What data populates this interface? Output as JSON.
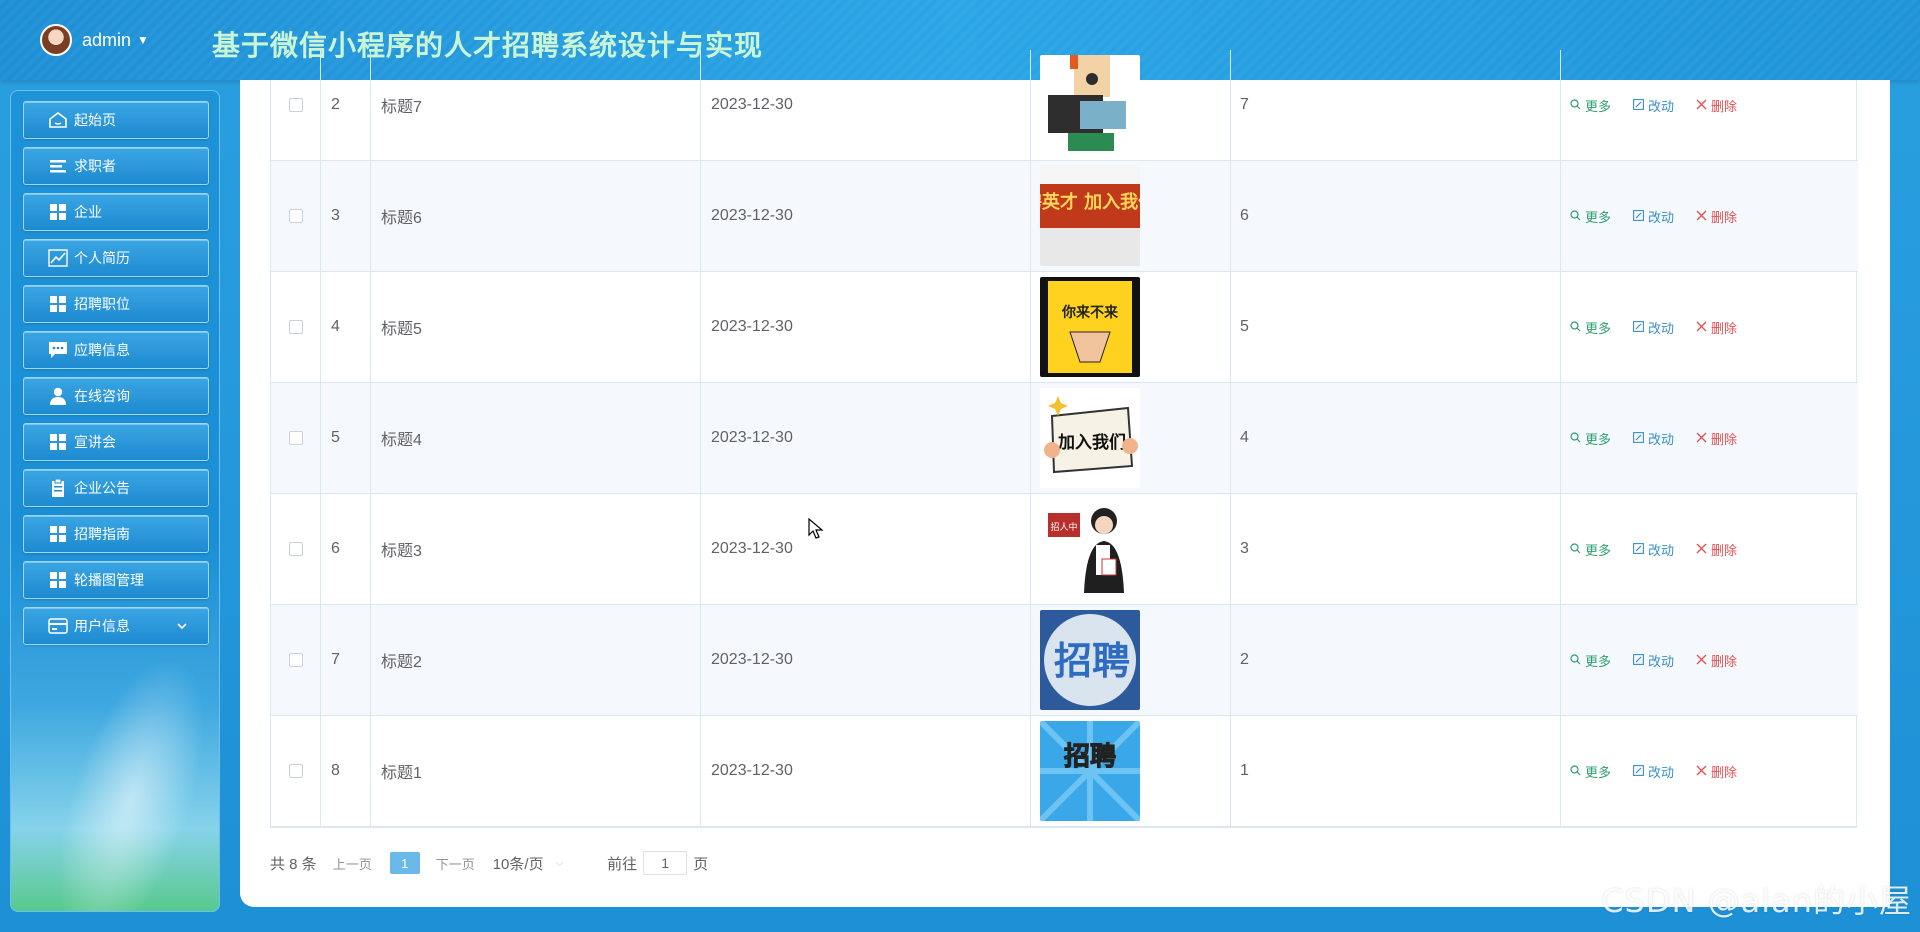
{
  "header": {
    "user_name": "admin",
    "title": "基于微信小程序的人才招聘系统设计与实现"
  },
  "sidebar": {
    "items": [
      {
        "label": "起始页",
        "icon": "home-icon"
      },
      {
        "label": "求职者",
        "icon": "list-icon"
      },
      {
        "label": "企业",
        "icon": "grid-icon"
      },
      {
        "label": "个人简历",
        "icon": "chart-icon"
      },
      {
        "label": "招聘职位",
        "icon": "grid-icon"
      },
      {
        "label": "应聘信息",
        "icon": "chat-icon"
      },
      {
        "label": "在线咨询",
        "icon": "user-icon"
      },
      {
        "label": "宣讲会",
        "icon": "grid-icon"
      },
      {
        "label": "企业公告",
        "icon": "clipboard-icon"
      },
      {
        "label": "招聘指南",
        "icon": "grid-icon"
      },
      {
        "label": "轮播图管理",
        "icon": "grid-icon"
      },
      {
        "label": "用户信息",
        "icon": "card-icon"
      }
    ]
  },
  "table": {
    "rows": [
      {
        "index": "2",
        "title": "标题7",
        "date": "2023-12-30",
        "count": "7",
        "image": "cartoon-recruiter-at-laptop"
      },
      {
        "index": "3",
        "title": "标题6",
        "date": "2023-12-30",
        "count": "6",
        "image": "recruit-talent-banner",
        "image_text": "诚聘英才 加入我们吧"
      },
      {
        "index": "4",
        "title": "标题5",
        "date": "2023-12-30",
        "count": "5",
        "image": "yellow-poster-pointing-hand",
        "image_text": "你来不来"
      },
      {
        "index": "5",
        "title": "标题4",
        "date": "2023-12-30",
        "count": "4",
        "image": "join-us-sign",
        "image_text": "加入我们"
      },
      {
        "index": "6",
        "title": "标题3",
        "date": "2023-12-30",
        "count": "3",
        "image": "recruiting-businesswoman",
        "image_text": "招人中"
      },
      {
        "index": "7",
        "title": "标题2",
        "date": "2023-12-30",
        "count": "2",
        "image": "blue-recruit-logo",
        "image_text": "招聘"
      },
      {
        "index": "8",
        "title": "标题1",
        "date": "2023-12-30",
        "count": "1",
        "image": "comic-recruit-poster",
        "image_text": "招聘"
      }
    ],
    "actions": {
      "more": "更多",
      "edit": "改动",
      "delete": "删除"
    }
  },
  "pagination": {
    "total": "共 8 条",
    "prev": "上一页",
    "current": "1",
    "next": "下一页",
    "page_size": "10条/页",
    "goto_prefix": "前往",
    "goto_value": "1",
    "goto_suffix": "页"
  },
  "watermark": "CSDN @alan的小屋",
  "colors": {
    "accent": "#1e90d6",
    "more": "#2f9e6f",
    "edit": "#3a8fc7",
    "delete": "#e05050"
  }
}
